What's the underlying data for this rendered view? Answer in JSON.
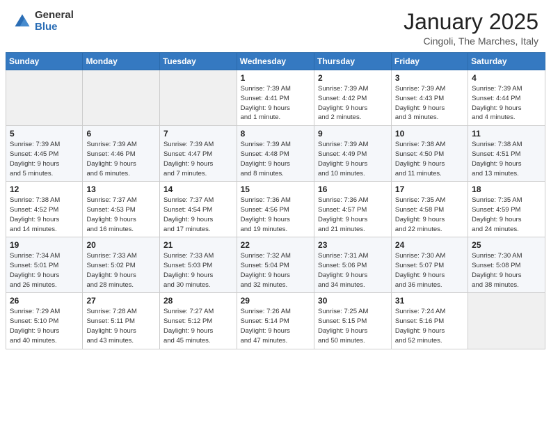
{
  "header": {
    "logo_general": "General",
    "logo_blue": "Blue",
    "main_title": "January 2025",
    "subtitle": "Cingoli, The Marches, Italy"
  },
  "calendar": {
    "days_of_week": [
      "Sunday",
      "Monday",
      "Tuesday",
      "Wednesday",
      "Thursday",
      "Friday",
      "Saturday"
    ],
    "weeks": [
      [
        {
          "day": "",
          "info": ""
        },
        {
          "day": "",
          "info": ""
        },
        {
          "day": "",
          "info": ""
        },
        {
          "day": "1",
          "info": "Sunrise: 7:39 AM\nSunset: 4:41 PM\nDaylight: 9 hours\nand 1 minute."
        },
        {
          "day": "2",
          "info": "Sunrise: 7:39 AM\nSunset: 4:42 PM\nDaylight: 9 hours\nand 2 minutes."
        },
        {
          "day": "3",
          "info": "Sunrise: 7:39 AM\nSunset: 4:43 PM\nDaylight: 9 hours\nand 3 minutes."
        },
        {
          "day": "4",
          "info": "Sunrise: 7:39 AM\nSunset: 4:44 PM\nDaylight: 9 hours\nand 4 minutes."
        }
      ],
      [
        {
          "day": "5",
          "info": "Sunrise: 7:39 AM\nSunset: 4:45 PM\nDaylight: 9 hours\nand 5 minutes."
        },
        {
          "day": "6",
          "info": "Sunrise: 7:39 AM\nSunset: 4:46 PM\nDaylight: 9 hours\nand 6 minutes."
        },
        {
          "day": "7",
          "info": "Sunrise: 7:39 AM\nSunset: 4:47 PM\nDaylight: 9 hours\nand 7 minutes."
        },
        {
          "day": "8",
          "info": "Sunrise: 7:39 AM\nSunset: 4:48 PM\nDaylight: 9 hours\nand 8 minutes."
        },
        {
          "day": "9",
          "info": "Sunrise: 7:39 AM\nSunset: 4:49 PM\nDaylight: 9 hours\nand 10 minutes."
        },
        {
          "day": "10",
          "info": "Sunrise: 7:38 AM\nSunset: 4:50 PM\nDaylight: 9 hours\nand 11 minutes."
        },
        {
          "day": "11",
          "info": "Sunrise: 7:38 AM\nSunset: 4:51 PM\nDaylight: 9 hours\nand 13 minutes."
        }
      ],
      [
        {
          "day": "12",
          "info": "Sunrise: 7:38 AM\nSunset: 4:52 PM\nDaylight: 9 hours\nand 14 minutes."
        },
        {
          "day": "13",
          "info": "Sunrise: 7:37 AM\nSunset: 4:53 PM\nDaylight: 9 hours\nand 16 minutes."
        },
        {
          "day": "14",
          "info": "Sunrise: 7:37 AM\nSunset: 4:54 PM\nDaylight: 9 hours\nand 17 minutes."
        },
        {
          "day": "15",
          "info": "Sunrise: 7:36 AM\nSunset: 4:56 PM\nDaylight: 9 hours\nand 19 minutes."
        },
        {
          "day": "16",
          "info": "Sunrise: 7:36 AM\nSunset: 4:57 PM\nDaylight: 9 hours\nand 21 minutes."
        },
        {
          "day": "17",
          "info": "Sunrise: 7:35 AM\nSunset: 4:58 PM\nDaylight: 9 hours\nand 22 minutes."
        },
        {
          "day": "18",
          "info": "Sunrise: 7:35 AM\nSunset: 4:59 PM\nDaylight: 9 hours\nand 24 minutes."
        }
      ],
      [
        {
          "day": "19",
          "info": "Sunrise: 7:34 AM\nSunset: 5:01 PM\nDaylight: 9 hours\nand 26 minutes."
        },
        {
          "day": "20",
          "info": "Sunrise: 7:33 AM\nSunset: 5:02 PM\nDaylight: 9 hours\nand 28 minutes."
        },
        {
          "day": "21",
          "info": "Sunrise: 7:33 AM\nSunset: 5:03 PM\nDaylight: 9 hours\nand 30 minutes."
        },
        {
          "day": "22",
          "info": "Sunrise: 7:32 AM\nSunset: 5:04 PM\nDaylight: 9 hours\nand 32 minutes."
        },
        {
          "day": "23",
          "info": "Sunrise: 7:31 AM\nSunset: 5:06 PM\nDaylight: 9 hours\nand 34 minutes."
        },
        {
          "day": "24",
          "info": "Sunrise: 7:30 AM\nSunset: 5:07 PM\nDaylight: 9 hours\nand 36 minutes."
        },
        {
          "day": "25",
          "info": "Sunrise: 7:30 AM\nSunset: 5:08 PM\nDaylight: 9 hours\nand 38 minutes."
        }
      ],
      [
        {
          "day": "26",
          "info": "Sunrise: 7:29 AM\nSunset: 5:10 PM\nDaylight: 9 hours\nand 40 minutes."
        },
        {
          "day": "27",
          "info": "Sunrise: 7:28 AM\nSunset: 5:11 PM\nDaylight: 9 hours\nand 43 minutes."
        },
        {
          "day": "28",
          "info": "Sunrise: 7:27 AM\nSunset: 5:12 PM\nDaylight: 9 hours\nand 45 minutes."
        },
        {
          "day": "29",
          "info": "Sunrise: 7:26 AM\nSunset: 5:14 PM\nDaylight: 9 hours\nand 47 minutes."
        },
        {
          "day": "30",
          "info": "Sunrise: 7:25 AM\nSunset: 5:15 PM\nDaylight: 9 hours\nand 50 minutes."
        },
        {
          "day": "31",
          "info": "Sunrise: 7:24 AM\nSunset: 5:16 PM\nDaylight: 9 hours\nand 52 minutes."
        },
        {
          "day": "",
          "info": ""
        }
      ]
    ]
  }
}
